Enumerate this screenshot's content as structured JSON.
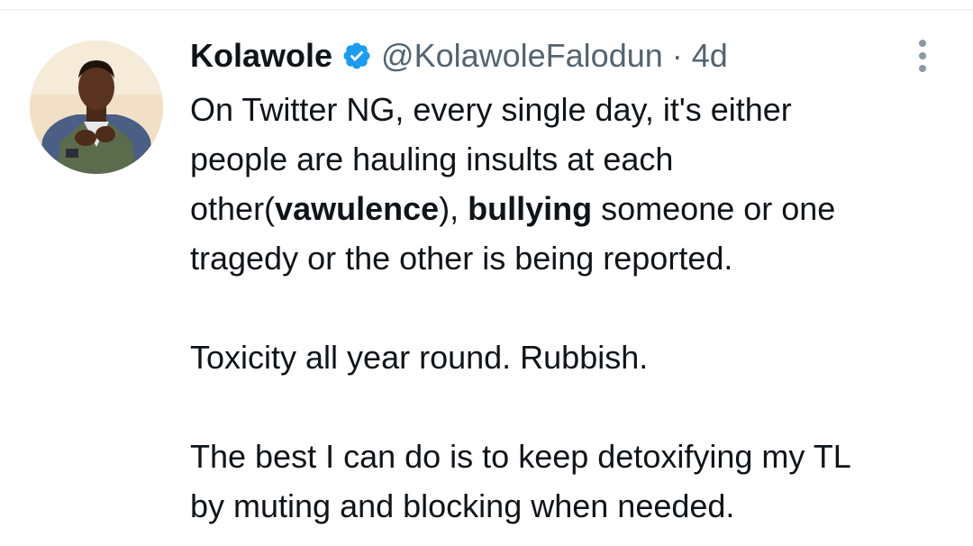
{
  "tweet": {
    "author": {
      "display_name": "Kolawole",
      "handle": "@KolawoleFalodun",
      "verified": true,
      "avatar_icon": "profile-photo-avatar"
    },
    "separator": "·",
    "timestamp": "4d",
    "more_icon": "more-vertical-icon",
    "paragraph1": {
      "line1": "On Twitter NG, every single day, it's either",
      "line2": "people are hauling insults at each",
      "line3_pre": "other(",
      "line3_bold1": "vawulence",
      "line3_mid": "), ",
      "line3_bold2": "bullying",
      "line3_post": " someone or one",
      "line4": "tragedy or the other is being reported."
    },
    "paragraph2": "Toxicity all year round. Rubbish.",
    "paragraph3": {
      "line1": "The best I can do is to keep detoxifying my TL",
      "line2": "by muting and blocking when needed."
    }
  },
  "colors": {
    "text_primary": "#0f1419",
    "text_secondary": "#536471",
    "verified_blue": "#1d9bf0",
    "more_dots": "#8b98a5",
    "divider": "#eff3f4"
  }
}
